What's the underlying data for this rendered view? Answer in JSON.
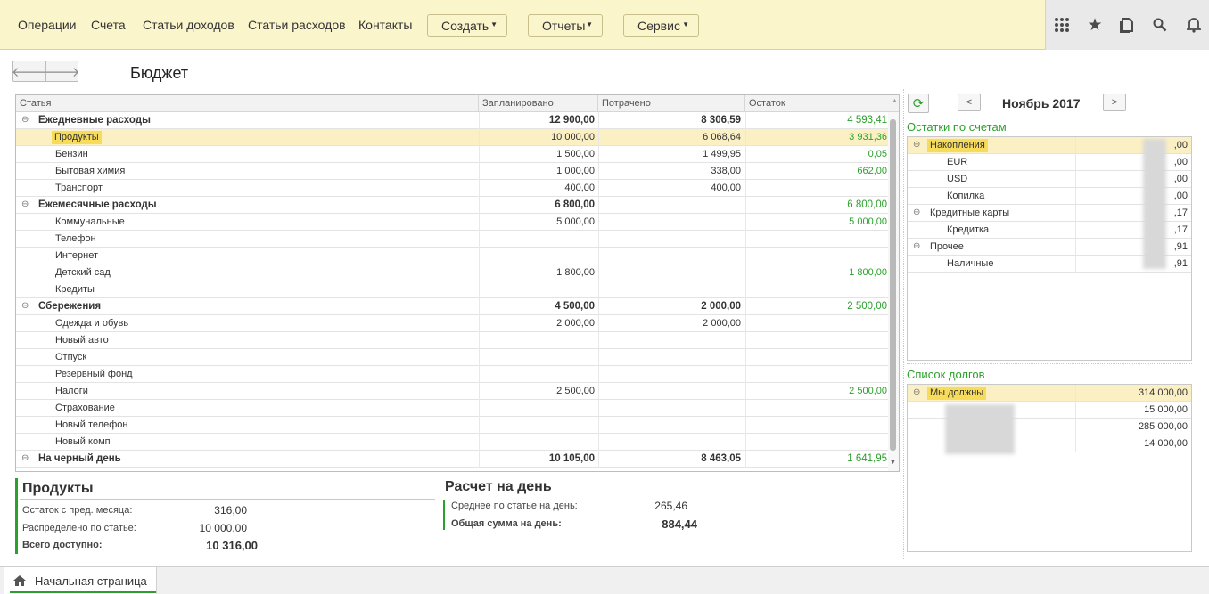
{
  "menu": {
    "items": [
      "Операции",
      "Счета",
      "Статьи доходов",
      "Статьи расходов",
      "Контакты"
    ],
    "create": "Создать",
    "reports": "Отчеты",
    "service": "Сервис"
  },
  "page": {
    "title": "Бюджет"
  },
  "table": {
    "columns": [
      "Статья",
      "Запланировано",
      "Потрачено",
      "Остаток"
    ],
    "rows": [
      {
        "type": "group",
        "name": "Ежедневные расходы",
        "planned": "12 900,00",
        "spent": "8 306,59",
        "rest": "4 593,41"
      },
      {
        "type": "item",
        "name": "Продукты",
        "planned": "10 000,00",
        "spent": "6 068,64",
        "rest": "3 931,36",
        "selected": true
      },
      {
        "type": "item",
        "name": "Бензин",
        "planned": "1 500,00",
        "spent": "1 499,95",
        "rest": "0,05"
      },
      {
        "type": "item",
        "name": "Бытовая химия",
        "planned": "1 000,00",
        "spent": "338,00",
        "rest": "662,00"
      },
      {
        "type": "item",
        "name": "Транспорт",
        "planned": "400,00",
        "spent": "400,00",
        "rest": ""
      },
      {
        "type": "group",
        "name": "Ежемесячные расходы",
        "planned": "6 800,00",
        "spent": "",
        "rest": "6 800,00"
      },
      {
        "type": "item",
        "name": "Коммунальные",
        "planned": "5 000,00",
        "spent": "",
        "rest": "5 000,00"
      },
      {
        "type": "item",
        "name": "Телефон",
        "planned": "",
        "spent": "",
        "rest": ""
      },
      {
        "type": "item",
        "name": "Интернет",
        "planned": "",
        "spent": "",
        "rest": ""
      },
      {
        "type": "item",
        "name": "Детский сад",
        "planned": "1 800,00",
        "spent": "",
        "rest": "1 800,00"
      },
      {
        "type": "item",
        "name": "Кредиты",
        "planned": "",
        "spent": "",
        "rest": ""
      },
      {
        "type": "group",
        "name": "Сбережения",
        "planned": "4 500,00",
        "spent": "2 000,00",
        "rest": "2 500,00"
      },
      {
        "type": "item",
        "name": "Одежда и обувь",
        "planned": "2 000,00",
        "spent": "2 000,00",
        "rest": ""
      },
      {
        "type": "item",
        "name": "Новый авто",
        "planned": "",
        "spent": "",
        "rest": ""
      },
      {
        "type": "item",
        "name": "Отпуск",
        "planned": "",
        "spent": "",
        "rest": ""
      },
      {
        "type": "item",
        "name": "Резервный фонд",
        "planned": "",
        "spent": "",
        "rest": ""
      },
      {
        "type": "item",
        "name": "Налоги",
        "planned": "2 500,00",
        "spent": "",
        "rest": "2 500,00"
      },
      {
        "type": "item",
        "name": "Страхование",
        "planned": "",
        "spent": "",
        "rest": ""
      },
      {
        "type": "item",
        "name": "Новый телефон",
        "planned": "",
        "spent": "",
        "rest": ""
      },
      {
        "type": "item",
        "name": "Новый комп",
        "planned": "",
        "spent": "",
        "rest": ""
      },
      {
        "type": "group",
        "name": "На черный день",
        "planned": "10 105,00",
        "spent": "8 463,05",
        "rest": "1 641,95"
      }
    ]
  },
  "detail": {
    "title": "Продукты",
    "rest_prev_label": "Остаток с пред. месяца:",
    "rest_prev_value": "316,00",
    "allocated_label": "Распределено по статье:",
    "allocated_value": "10 000,00",
    "total_label": "Всего доступно:",
    "total_value": "10 316,00"
  },
  "calc": {
    "title": "Расчет на день",
    "avg_label": "Среднее по статье на день:",
    "avg_value": "265,46",
    "total_label": "Общая сумма на день:",
    "total_value": "884,44"
  },
  "period": {
    "label": "Ноябрь 2017",
    "prev": "<",
    "next": ">"
  },
  "balances": {
    "title": "Остатки по счетам",
    "rows": [
      {
        "type": "group",
        "name": "Накопления",
        "value": ",00",
        "selected": true
      },
      {
        "type": "item",
        "name": "EUR",
        "value": ",00"
      },
      {
        "type": "item",
        "name": "USD",
        "value": ",00"
      },
      {
        "type": "item",
        "name": "Копилка",
        "value": ",00"
      },
      {
        "type": "group",
        "name": "Кредитные карты",
        "value": ",17"
      },
      {
        "type": "item",
        "name": "Кредитка",
        "value": ",17"
      },
      {
        "type": "group",
        "name": "Прочее",
        "value": ",91"
      },
      {
        "type": "item",
        "name": "Наличные",
        "value": ",91"
      }
    ]
  },
  "debts": {
    "title": "Список долгов",
    "rows": [
      {
        "type": "group",
        "name": "Мы должны",
        "value": "314 000,00",
        "selected": true
      },
      {
        "type": "item",
        "name": "",
        "value": "15 000,00"
      },
      {
        "type": "item",
        "name": "",
        "value": "285 000,00"
      },
      {
        "type": "item",
        "name": "",
        "value": "14 000,00"
      }
    ]
  },
  "bottom": {
    "home_tab": "Начальная страница"
  },
  "colors": {
    "accent": "#2ca02c",
    "topbar": "#fbf5cc",
    "selection": "#fbf0c4",
    "highlight": "#f7dc5c"
  }
}
